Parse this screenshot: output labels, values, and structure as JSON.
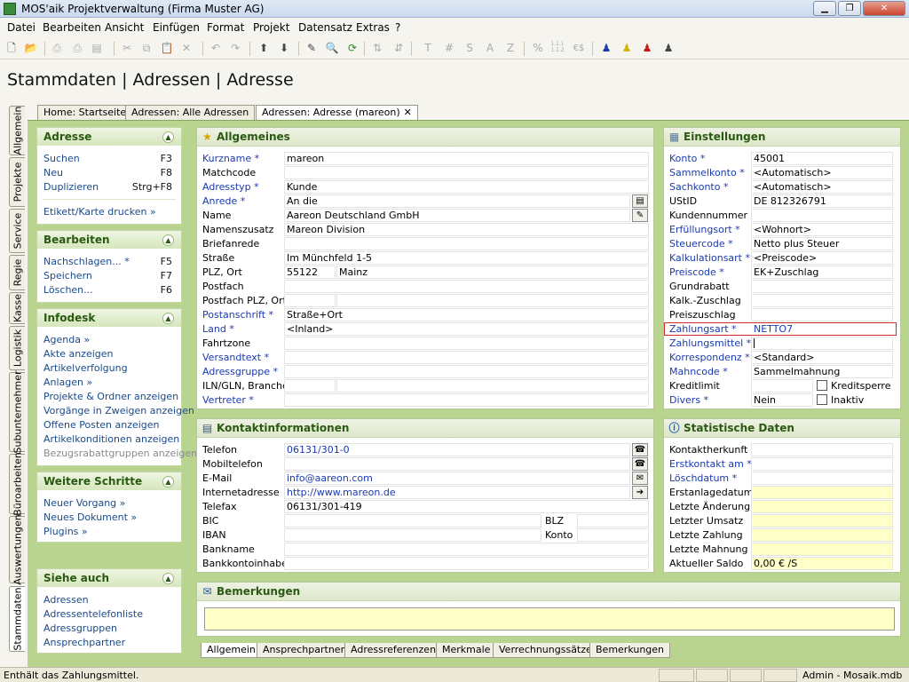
{
  "window": {
    "title": "MOS'aik Projektverwaltung (Firma Muster AG)"
  },
  "menu": [
    "Datei",
    "Bearbeiten",
    "Ansicht",
    "Einfügen",
    "Format",
    "Projekt",
    "Datensatz",
    "Extras",
    "?"
  ],
  "toolbar": {
    "glyphs": [
      "T",
      "#",
      "S",
      "A",
      "Z",
      "%",
      "1.1.1\n1.1.2",
      "€$"
    ]
  },
  "page": {
    "title": "Stammdaten | Adressen | Adresse"
  },
  "doctabs": [
    {
      "label": "Home: Startseite"
    },
    {
      "label": "Adressen: Alle Adressen"
    },
    {
      "label": "Adressen: Adresse (mareon)"
    }
  ],
  "vtabs": [
    "Allgemein",
    "Projekte",
    "Service",
    "Regie",
    "Kasse",
    "Logistik",
    "Subunternehmer",
    "Büroarbeiten",
    "Auswertungen",
    "Stammdaten"
  ],
  "side": {
    "adresse": {
      "title": "Adresse",
      "items": [
        {
          "label": "Suchen",
          "key": "F3"
        },
        {
          "label": "Neu",
          "key": "F8"
        },
        {
          "label": "Duplizieren",
          "key": "Strg+F8"
        }
      ],
      "extra": "Etikett/Karte drucken »"
    },
    "bearbeiten": {
      "title": "Bearbeiten",
      "items": [
        {
          "label": "Nachschlagen... *",
          "key": "F5"
        },
        {
          "label": "Speichern",
          "key": "F7"
        },
        {
          "label": "Löschen...",
          "key": "F6"
        }
      ]
    },
    "infodesk": {
      "title": "Infodesk",
      "items": [
        "Agenda »",
        "Akte anzeigen",
        "Artikelverfolgung",
        "Anlagen »",
        "Projekte & Ordner anzeigen",
        "Vorgänge in Zweigen anzeigen",
        "Offene Posten anzeigen",
        "Artikelkonditionen anzeigen",
        "Bezugsrabattgruppen anzeigen"
      ]
    },
    "weitere": {
      "title": "Weitere Schritte",
      "items": [
        "Neuer Vorgang »",
        "Neues Dokument »",
        "Plugins »"
      ]
    },
    "siehe": {
      "title": "Siehe auch",
      "items": [
        "Adressen",
        "Adressentelefonliste",
        "Adressgruppen",
        "Ansprechpartner"
      ]
    }
  },
  "allgemeines": {
    "title": "Allgemeines",
    "rows": [
      {
        "label": "Kurzname *",
        "value": "mareon",
        "req": true
      },
      {
        "label": "Matchcode",
        "value": ""
      },
      {
        "label": "Adresstyp *",
        "value": "Kunde",
        "req": true
      },
      {
        "label": "Anrede *",
        "value": "An die",
        "req": true
      },
      {
        "label": "Name",
        "value": "Aareon Deutschland GmbH"
      },
      {
        "label": "Namenszusatz",
        "value": "Mareon Division"
      },
      {
        "label": "Briefanrede",
        "value": ""
      },
      {
        "label": "Straße",
        "value": "Im Münchfeld 1-5"
      },
      {
        "label": "PLZ, Ort",
        "value": "55122",
        "value2": "Mainz"
      },
      {
        "label": "Postfach",
        "value": ""
      },
      {
        "label": "Postfach PLZ, Ort",
        "value": "",
        "value2": ""
      },
      {
        "label": "Postanschrift *",
        "value": "Straße+Ort",
        "req": true
      },
      {
        "label": "Land *",
        "value": "<Inland>",
        "req": true
      },
      {
        "label": "Fahrtzone",
        "value": ""
      },
      {
        "label": "Versandtext *",
        "value": "",
        "req": true
      },
      {
        "label": "Adressgruppe *",
        "value": "",
        "req": true
      },
      {
        "label": "ILN/GLN, Branche",
        "value": "",
        "value2": ""
      },
      {
        "label": "Vertreter *",
        "value": "",
        "req": true
      }
    ]
  },
  "einstellungen": {
    "title": "Einstellungen",
    "rows": [
      {
        "label": "Konto *",
        "value": "45001",
        "req": true
      },
      {
        "label": "Sammelkonto *",
        "value": "<Automatisch>",
        "req": true
      },
      {
        "label": "Sachkonto *",
        "value": "<Automatisch>",
        "req": true
      },
      {
        "label": "UStID",
        "value": "DE 812326791"
      },
      {
        "label": "Kundennummer",
        "value": ""
      },
      {
        "label": "Erfüllungsort *",
        "value": "<Wohnort>",
        "req": true
      },
      {
        "label": "Steuercode *",
        "value": "Netto plus Steuer",
        "req": true
      },
      {
        "label": "Kalkulationsart *",
        "value": "<Preiscode>",
        "req": true
      },
      {
        "label": "Preiscode *",
        "value": "EK+Zuschlag",
        "req": true
      },
      {
        "label": "Grundrabatt",
        "value": ""
      },
      {
        "label": "Kalk.-Zuschlag",
        "value": ""
      },
      {
        "label": "Preiszuschlag",
        "value": ""
      },
      {
        "label": "Zahlungsart *",
        "value": "NETTO7",
        "req": true
      },
      {
        "label": "Zahlungsmittel *",
        "value": "",
        "req": true
      },
      {
        "label": "Korrespondenz *",
        "value": "<Standard>",
        "req": true
      },
      {
        "label": "Mahncode *",
        "value": "Sammelmahnung",
        "req": true
      },
      {
        "label": "Kreditlimit",
        "value": ""
      },
      {
        "label": "Divers *",
        "value": "Nein",
        "req": true
      }
    ],
    "chk1": "Kreditsperre",
    "chk2": "Inaktiv"
  },
  "kontakt": {
    "title": "Kontaktinformationen",
    "rows": [
      {
        "label": "Telefon",
        "value": "06131/301-0"
      },
      {
        "label": "Mobiltelefon",
        "value": ""
      },
      {
        "label": "E-Mail",
        "value": "info@aareon.com"
      },
      {
        "label": "Internetadresse",
        "value": "http://www.mareon.de"
      },
      {
        "label": "Telefax",
        "value": "06131/301-419"
      },
      {
        "label": "BIC",
        "value": "",
        "label2": "BLZ",
        "value2": ""
      },
      {
        "label": "IBAN",
        "value": "",
        "label2": "Konto",
        "value2": ""
      },
      {
        "label": "Bankname",
        "value": ""
      },
      {
        "label": "Bankkontoinhaber",
        "value": ""
      }
    ]
  },
  "statistik": {
    "title": "Statistische Daten",
    "rows": [
      {
        "label": "Kontaktherkunft",
        "value": ""
      },
      {
        "label": "Erstkontakt am *",
        "value": "",
        "req": true
      },
      {
        "label": "Löschdatum *",
        "value": "",
        "req": true
      },
      {
        "label": "Erstanlagedatum",
        "value": ""
      },
      {
        "label": "Letzte Änderung",
        "value": ""
      },
      {
        "label": "Letzter Umsatz",
        "value": ""
      },
      {
        "label": "Letzte Zahlung",
        "value": ""
      },
      {
        "label": "Letzte Mahnung",
        "value": ""
      },
      {
        "label": "Aktueller Saldo",
        "value": "0,00 € /S"
      }
    ]
  },
  "bemerkungen": {
    "title": "Bemerkungen"
  },
  "bottomtabs": [
    "Allgemein",
    "Ansprechpartner",
    "Adressreferenzen",
    "Merkmale",
    "Verrechnungssätze",
    "Bemerkungen"
  ],
  "status": {
    "left": "Enthält das Zahlungsmittel.",
    "right": "Admin - Mosaik.mdb"
  }
}
